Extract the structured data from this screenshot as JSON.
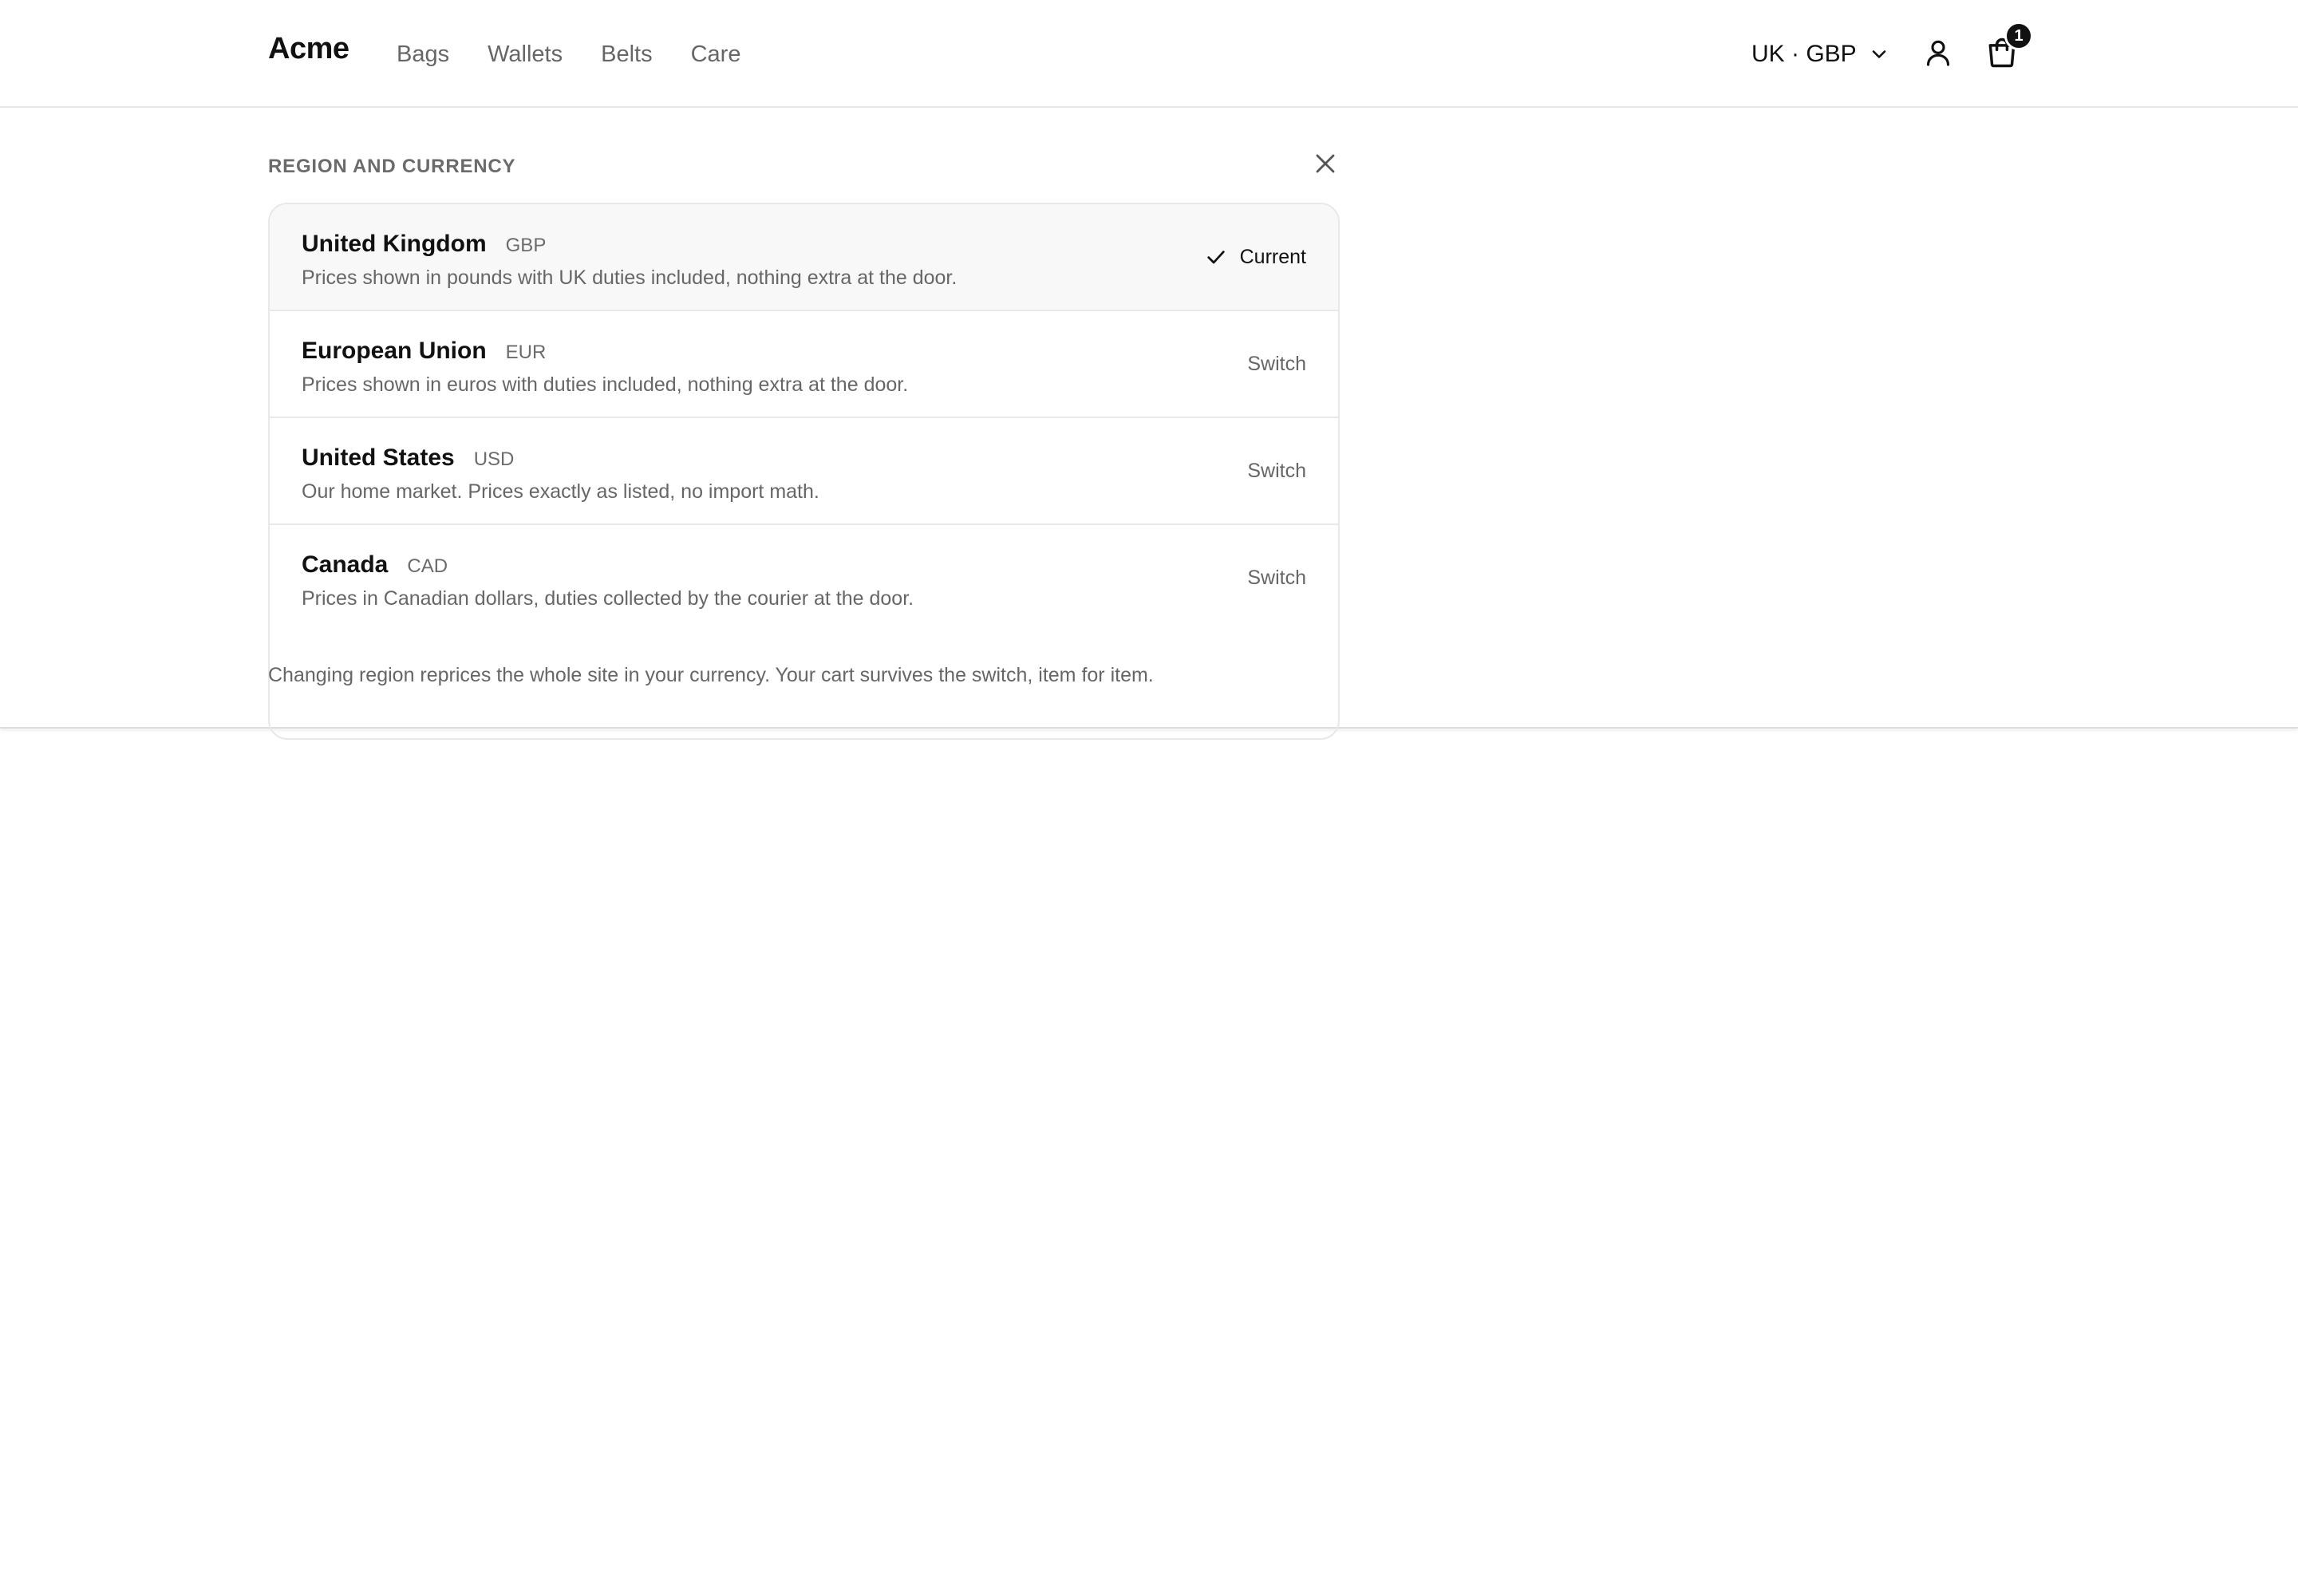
{
  "header": {
    "logo": "Acme",
    "nav": [
      "Bags",
      "Wallets",
      "Belts",
      "Care"
    ],
    "region_label": "UK · GBP",
    "cart_count": "1",
    "icons": {
      "region_chevron": "chevron-down-icon",
      "account": "user-icon",
      "cart": "shopping-bag-icon"
    }
  },
  "region_panel": {
    "title": "REGION AND CURRENCY",
    "close_icon": "close-icon",
    "regions": [
      {
        "name": "United Kingdom",
        "code": "GBP",
        "description": "Prices shown in pounds with UK duties included, nothing extra at the door.",
        "action": "Current",
        "is_current": true
      },
      {
        "name": "European Union",
        "code": "EUR",
        "description": "Prices shown in euros with duties included, nothing extra at the door.",
        "action": "Switch",
        "is_current": false
      },
      {
        "name": "United States",
        "code": "USD",
        "description": "Our home market. Prices exactly as listed, no import math.",
        "action": "Switch",
        "is_current": false
      },
      {
        "name": "Canada",
        "code": "CAD",
        "description": "Prices in Canadian dollars, duties collected by the courier at the door.",
        "action": "Switch",
        "is_current": false
      }
    ],
    "note": "Changing region reprices the whole site in your currency. Your cart survives the switch, item for item."
  },
  "colors": {
    "text_primary": "#111111",
    "text_secondary": "#666666",
    "border": "#e8e8e8",
    "current_row_bg": "#f8f8f8",
    "badge_bg": "#111111"
  }
}
